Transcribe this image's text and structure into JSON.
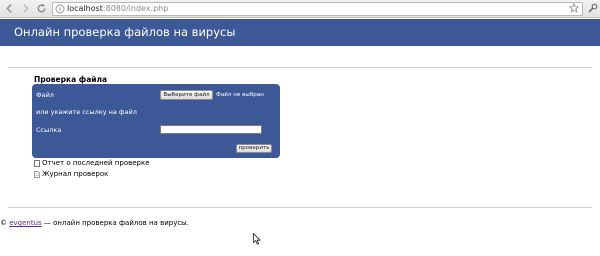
{
  "browser": {
    "url_host": "localhost",
    "url_rest": ":8080/index.php"
  },
  "header": {
    "title": "Онлайн проверка файлов на вирусы"
  },
  "form": {
    "section_title": "Проверка файла",
    "file_label": "Файл",
    "choose_button": "Выберите файл",
    "file_status": "Файл не выбран",
    "or_label": "или укажите ссылку на файл",
    "link_label": "Ссылка",
    "link_value": "",
    "submit_button": "проверить"
  },
  "links": {
    "last_report": "Отчет о последней проверке",
    "check_log": "Журнал проверок"
  },
  "footer": {
    "copyright": "©",
    "author": "evgentus",
    "tagline": " — онлайн проверка файлов на вирусы."
  },
  "colors": {
    "brand": "#3d5897",
    "link_visited": "#5a2c91"
  }
}
